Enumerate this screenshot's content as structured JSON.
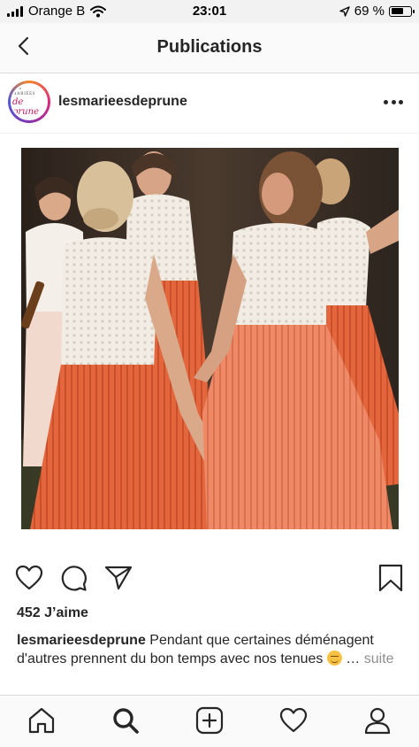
{
  "status_bar": {
    "carrier": "Orange B",
    "time": "23:01",
    "battery": "69 %",
    "battery_level": 0.69,
    "icons": [
      "signal-icon",
      "wifi-icon",
      "location-icon",
      "battery-icon"
    ]
  },
  "header": {
    "title": "Publications",
    "back_icon": "chevron-left-icon"
  },
  "post": {
    "avatar_logo_top": "LES MARIÉES",
    "avatar_logo_script": "de prune",
    "username": "lesmarieesdeprune",
    "more_icon": "more-horizontal-icon",
    "likes": "452 J’aime",
    "caption": {
      "username": "lesmarieesdeprune",
      "text": " Pendant que certaines déménagent d'autres prennent du bon temps avec nos tenues ",
      "ellipsis": " … ",
      "more": "suite"
    },
    "actions": [
      "heart-icon",
      "comment-icon",
      "share-icon",
      "bookmark-icon"
    ]
  },
  "tab_bar": {
    "items": [
      "home-icon",
      "search-icon",
      "add-post-icon",
      "activity-heart-icon",
      "profile-icon"
    ],
    "active": "search-icon"
  }
}
